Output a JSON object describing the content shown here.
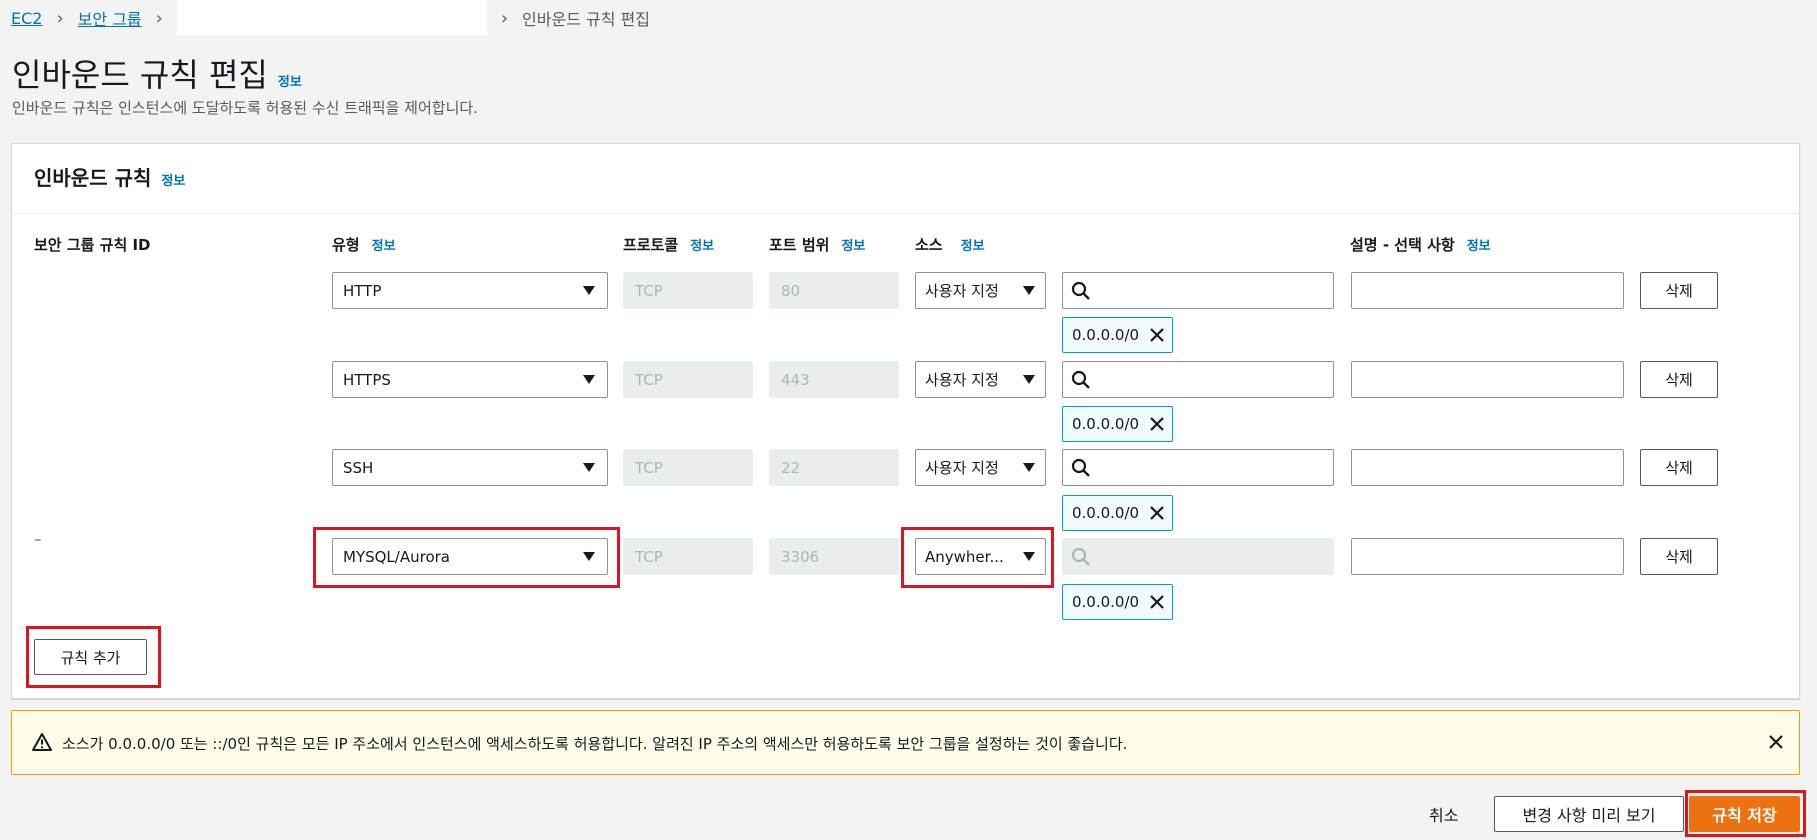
{
  "breadcrumb": {
    "items": [
      "EC2",
      "보안 그룹"
    ],
    "current": "인바운드 규칙 편집"
  },
  "page": {
    "title": "인바운드 규칙 편집",
    "info": "정보",
    "description": "인바운드 규칙은 인스턴스에 도달하도록 허용된 수신 트래픽을 제어합니다."
  },
  "panel": {
    "title": "인바운드 규칙",
    "info": "정보",
    "columns": {
      "rule_id": "보안 그룹 규칙 ID",
      "type": "유형",
      "protocol": "프로토콜",
      "port": "포트 범위",
      "source": "소스",
      "description": "설명 - 선택 사항",
      "info": "정보"
    },
    "rules": [
      {
        "id": "",
        "type": "HTTP",
        "protocol": "TCP",
        "port": "80",
        "source": "사용자 지정",
        "cidr": "0.0.0.0/0",
        "delete": "삭제"
      },
      {
        "id": "",
        "type": "HTTPS",
        "protocol": "TCP",
        "port": "443",
        "source": "사용자 지정",
        "cidr": "0.0.0.0/0",
        "delete": "삭제"
      },
      {
        "id": "",
        "type": "SSH",
        "protocol": "TCP",
        "port": "22",
        "source": "사용자 지정",
        "cidr": "0.0.0.0/0",
        "delete": "삭제"
      },
      {
        "id": "–",
        "type": "MYSQL/Aurora",
        "protocol": "TCP",
        "port": "3306",
        "source": "Anywher...",
        "cidr": "0.0.0.0/0",
        "delete": "삭제"
      }
    ],
    "add_rule": "규칙 추가"
  },
  "warning": {
    "text": "소스가 0.0.0.0/0 또는 ::/0인 규칙은 모든 IP 주소에서 인스턴스에 액세스하도록 허용합니다. 알려진 IP 주소의 액세스만 허용하도록 보안 그룹을 설정하는 것이 좋습니다."
  },
  "footer": {
    "cancel": "취소",
    "preview": "변경 사항 미리 보기",
    "save": "규칙 저장"
  },
  "colors": {
    "link": "#0073bb",
    "primary": "#ec7211",
    "highlight": "#e0141e",
    "warning_border": "#ff9900"
  }
}
